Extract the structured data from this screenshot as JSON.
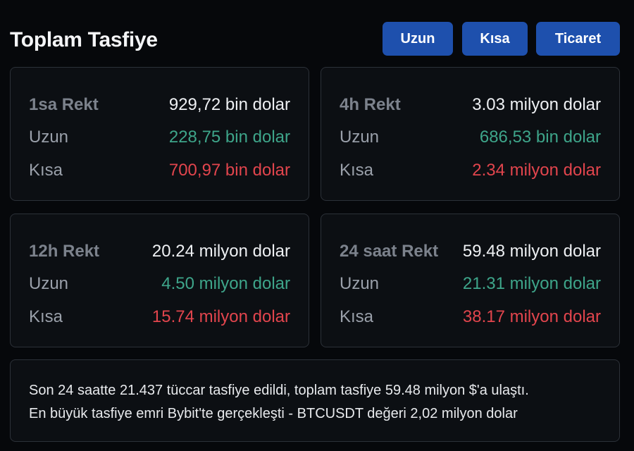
{
  "header": {
    "title": "Toplam Tasfiye",
    "buttons": {
      "long": "Uzun",
      "short": "Kısa",
      "trade": "Ticaret"
    },
    "button_color": "#1e50ad"
  },
  "colors": {
    "long": "#3ea58a",
    "short": "#e2454d",
    "background": "#06080b",
    "card": "#0c0f13"
  },
  "cards": [
    {
      "label": "1sa Rekt",
      "total": "929,72 bin dolar",
      "long_label": "Uzun",
      "long_value": "228,75 bin dolar",
      "short_label": "Kısa",
      "short_value": "700,97 bin dolar"
    },
    {
      "label": "4h Rekt",
      "total": "3.03 milyon dolar",
      "long_label": "Uzun",
      "long_value": "686,53 bin dolar",
      "short_label": "Kısa",
      "short_value": "2.34 milyon dolar"
    },
    {
      "label": "12h Rekt",
      "total": "20.24 milyon dolar",
      "long_label": "Uzun",
      "long_value": "4.50 milyon dolar",
      "short_label": "Kısa",
      "short_value": "15.74 milyon dolar"
    },
    {
      "label": "24 saat Rekt",
      "total": "59.48 milyon dolar",
      "long_label": "Uzun",
      "long_value": "21.31 milyon dolar",
      "short_label": "Kısa",
      "short_value": "38.17 milyon dolar"
    }
  ],
  "summary": {
    "line1": "Son 24 saatte 21.437 tüccar tasfiye edildi, toplam tasfiye 59.48 milyon $'a ulaştı.",
    "line2": "En büyük tasfiye emri Bybit'te gerçekleşti - BTCUSDT değeri 2,02 milyon dolar"
  }
}
